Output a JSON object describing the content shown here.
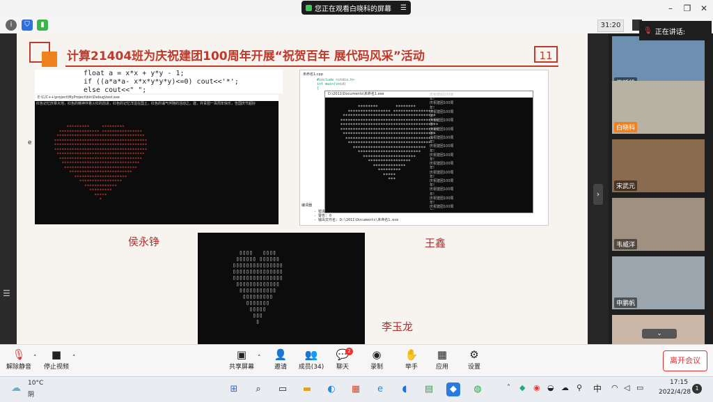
{
  "window": {
    "share_banner": "您正在观看白晓科的屏幕",
    "banner_menu_icon": "menu-icon",
    "min": "–",
    "restore": "❐",
    "close": "✕"
  },
  "meeting": {
    "timer": "31:20",
    "speaking_label": "正在讲话:"
  },
  "slide": {
    "title": "计算21404班为庆祝建团100周年开展“祝贺百年  展代码风采”活动",
    "page_number": "11",
    "code_lines": [
      "float a = x*x + y*y - 1;",
      "if ((a*a*a- x*x*y*y*y)<=0)  cout<<'*';",
      "else cout<<\" \";"
    ],
    "left_console_title": "E:\\C/C++\\project\\MyProject\\bin\\Debug\\test.exe",
    "left_console_text": "红色记忆庆章大地，红色的精神伴着火红的前进，红色的记忆洋溢在国土，红色的诵气伴随的活动之，建，共青团一百周年快乐，告国庆节超好",
    "left_console_char": "e",
    "ide_tab": "未命名1.cpp",
    "ide_code": [
      "#include <stdio.h>",
      "int main(void)",
      "{"
    ],
    "right_console_title": "D:\\2011\\Documents\\未命名1.exe",
    "right_console_repeat": "庆祝建团100周年!",
    "ide_bottom_label": "编译器",
    "ide_log": [
      "- 错误: 0",
      "- 警告: 0",
      "- 输出文件名: D:\\2011\\Documents\\未命名1.exe"
    ],
    "names": {
      "left": "侯永铮",
      "right": "王鑫",
      "bottom": "李玉龙"
    }
  },
  "participants": [
    {
      "name": "王延凯",
      "mic": "muted"
    },
    {
      "name": "白晓科",
      "mic": "speaking"
    },
    {
      "name": "宋武元",
      "mic": "muted"
    },
    {
      "name": "韦威洋",
      "mic": "muted"
    },
    {
      "name": "申鹏帆",
      "mic": "muted"
    }
  ],
  "toolbar": {
    "unmute": "解除静音",
    "stop_video": "停止视频",
    "share": "共享屏幕",
    "invite": "邀请",
    "members": "成员(34)",
    "chat": "聊天",
    "chat_badge": "2",
    "record": "录制",
    "raise_hand": "举手",
    "apps": "应用",
    "settings": "设置",
    "leave": "离开会议"
  },
  "taskbar": {
    "temp": "10°C",
    "weather": "阴",
    "time": "17:15",
    "date": "2022/4/28",
    "ime": "中",
    "notif": "1"
  },
  "colors": {
    "accent_red": "#c0392b",
    "orange": "#f0821e",
    "heart_red": "#e0463c"
  }
}
